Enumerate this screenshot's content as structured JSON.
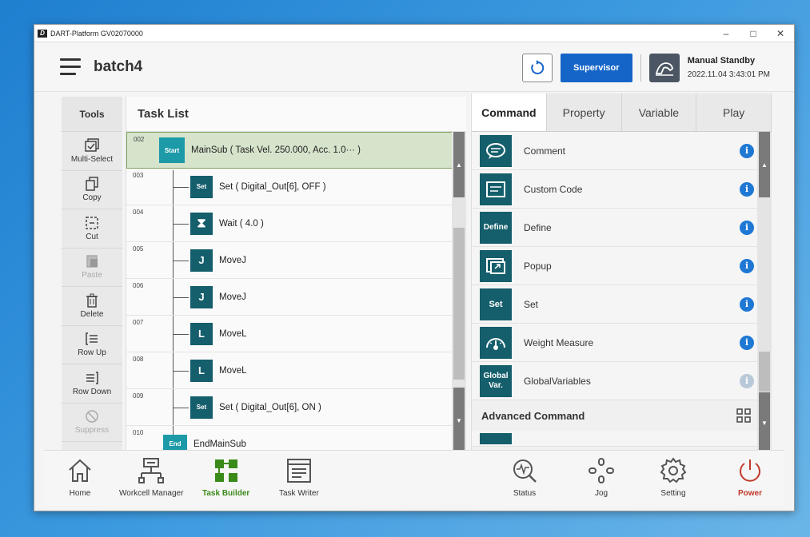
{
  "window": {
    "title": "DART-Platform GV02070000",
    "minimize": "–",
    "maximize": "□",
    "close": "✕"
  },
  "header": {
    "task_name": "batch4",
    "supervisor_label": "Supervisor",
    "status_mode": "Manual Standby",
    "status_time": "2022.11.04 3:43:01 PM"
  },
  "tools": {
    "title": "Tools",
    "items": [
      {
        "label": "Multi-Select",
        "icon": "multi-select-icon",
        "enabled": true
      },
      {
        "label": "Copy",
        "icon": "copy-icon",
        "enabled": true
      },
      {
        "label": "Cut",
        "icon": "cut-icon",
        "enabled": true
      },
      {
        "label": "Paste",
        "icon": "paste-icon",
        "enabled": false
      },
      {
        "label": "Delete",
        "icon": "trash-icon",
        "enabled": true
      },
      {
        "label": "Row Up",
        "icon": "row-up-icon",
        "enabled": true
      },
      {
        "label": "Row Down",
        "icon": "row-down-icon",
        "enabled": true
      },
      {
        "label": "Suppress",
        "icon": "suppress-icon",
        "enabled": false
      }
    ]
  },
  "tasklist": {
    "title": "Task List",
    "rows": [
      {
        "line": "002",
        "badge": "Start",
        "text": "MainSub  ( Task Vel. 250.000, Acc. 1.0··· )"
      },
      {
        "line": "003",
        "badge": "Set",
        "text": "Set  ( Digital_Out[6], OFF )"
      },
      {
        "line": "004",
        "badge": "⧗",
        "text": "Wait  ( 4.0 )"
      },
      {
        "line": "005",
        "badge": "J",
        "text": "MoveJ"
      },
      {
        "line": "006",
        "badge": "J",
        "text": "MoveJ"
      },
      {
        "line": "007",
        "badge": "L",
        "text": "MoveL"
      },
      {
        "line": "008",
        "badge": "L",
        "text": "MoveL"
      },
      {
        "line": "009",
        "badge": "Set",
        "text": "Set  ( Digital_Out[6], ON )"
      },
      {
        "line": "010",
        "badge": "End",
        "text": "EndMainSub"
      }
    ]
  },
  "command_panel": {
    "tabs": [
      "Command",
      "Property",
      "Variable",
      "Play"
    ],
    "active_tab": "Command",
    "commands": [
      {
        "name": "Comment",
        "icon": "comment-icon",
        "badge": ""
      },
      {
        "name": "Custom Code",
        "icon": "code-icon",
        "badge": ""
      },
      {
        "name": "Define",
        "icon": "define-icon",
        "badge": "Define"
      },
      {
        "name": "Popup",
        "icon": "popup-icon",
        "badge": ""
      },
      {
        "name": "Set",
        "icon": "set-icon",
        "badge": "Set"
      },
      {
        "name": "Weight Measure",
        "icon": "gauge-icon",
        "badge": ""
      },
      {
        "name": "GlobalVariables",
        "icon": "global-var-icon",
        "badge": "Global Var."
      }
    ],
    "advanced_label": "Advanced Command",
    "info_glyph": "i"
  },
  "bottom_nav": [
    {
      "label": "Home",
      "icon": "home-icon"
    },
    {
      "label": "Workcell Manager",
      "icon": "workcell-icon"
    },
    {
      "label": "Task Builder",
      "icon": "task-builder-icon"
    },
    {
      "label": "Task Writer",
      "icon": "task-writer-icon"
    },
    {
      "label": "Status",
      "icon": "status-icon"
    },
    {
      "label": "Jog",
      "icon": "jog-icon"
    },
    {
      "label": "Setting",
      "icon": "gear-icon"
    },
    {
      "label": "Power",
      "icon": "power-icon"
    }
  ],
  "colors": {
    "accent": "#1565c8",
    "teal": "#155e6b",
    "active_green": "#3a8a1a",
    "power_red": "#c0392b",
    "info_blue": "#1e78d4"
  }
}
